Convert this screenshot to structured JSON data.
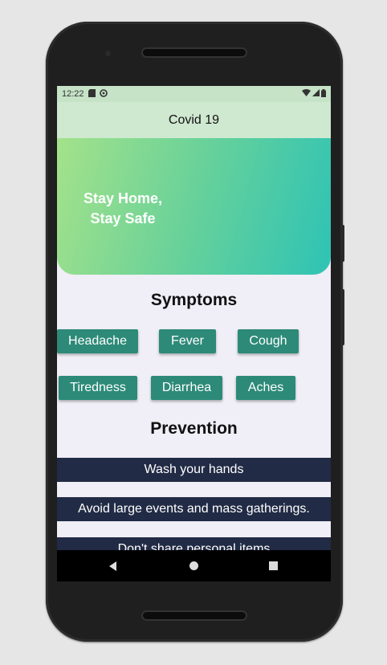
{
  "status_bar": {
    "time": "12:22",
    "left_icons": [
      "sd-card-icon",
      "sync-icon"
    ],
    "right_icons": [
      "wifi-icon",
      "signal-icon",
      "battery-icon"
    ]
  },
  "app_bar": {
    "title": "Covid 19"
  },
  "hero": {
    "line1": "Stay Home,",
    "line2": "Stay Safe"
  },
  "symptoms": {
    "title": "Symptoms",
    "items": [
      "Headache",
      "Fever",
      "Cough",
      "Tiredness",
      "Diarrhea",
      "Aches"
    ]
  },
  "prevention": {
    "title": "Prevention",
    "items": [
      "Wash your hands",
      "Avoid large events and mass gatherings.",
      "Don't share personal items"
    ]
  },
  "nav_bar": {
    "icons": [
      "back-icon",
      "home-icon",
      "recents-icon"
    ]
  },
  "colors": {
    "app_bar": "#cfe8d0",
    "chip": "#2d8a78",
    "prevention_bar": "#212b45",
    "gradient_start": "#a4e28a",
    "gradient_end": "#2ec3b5"
  }
}
